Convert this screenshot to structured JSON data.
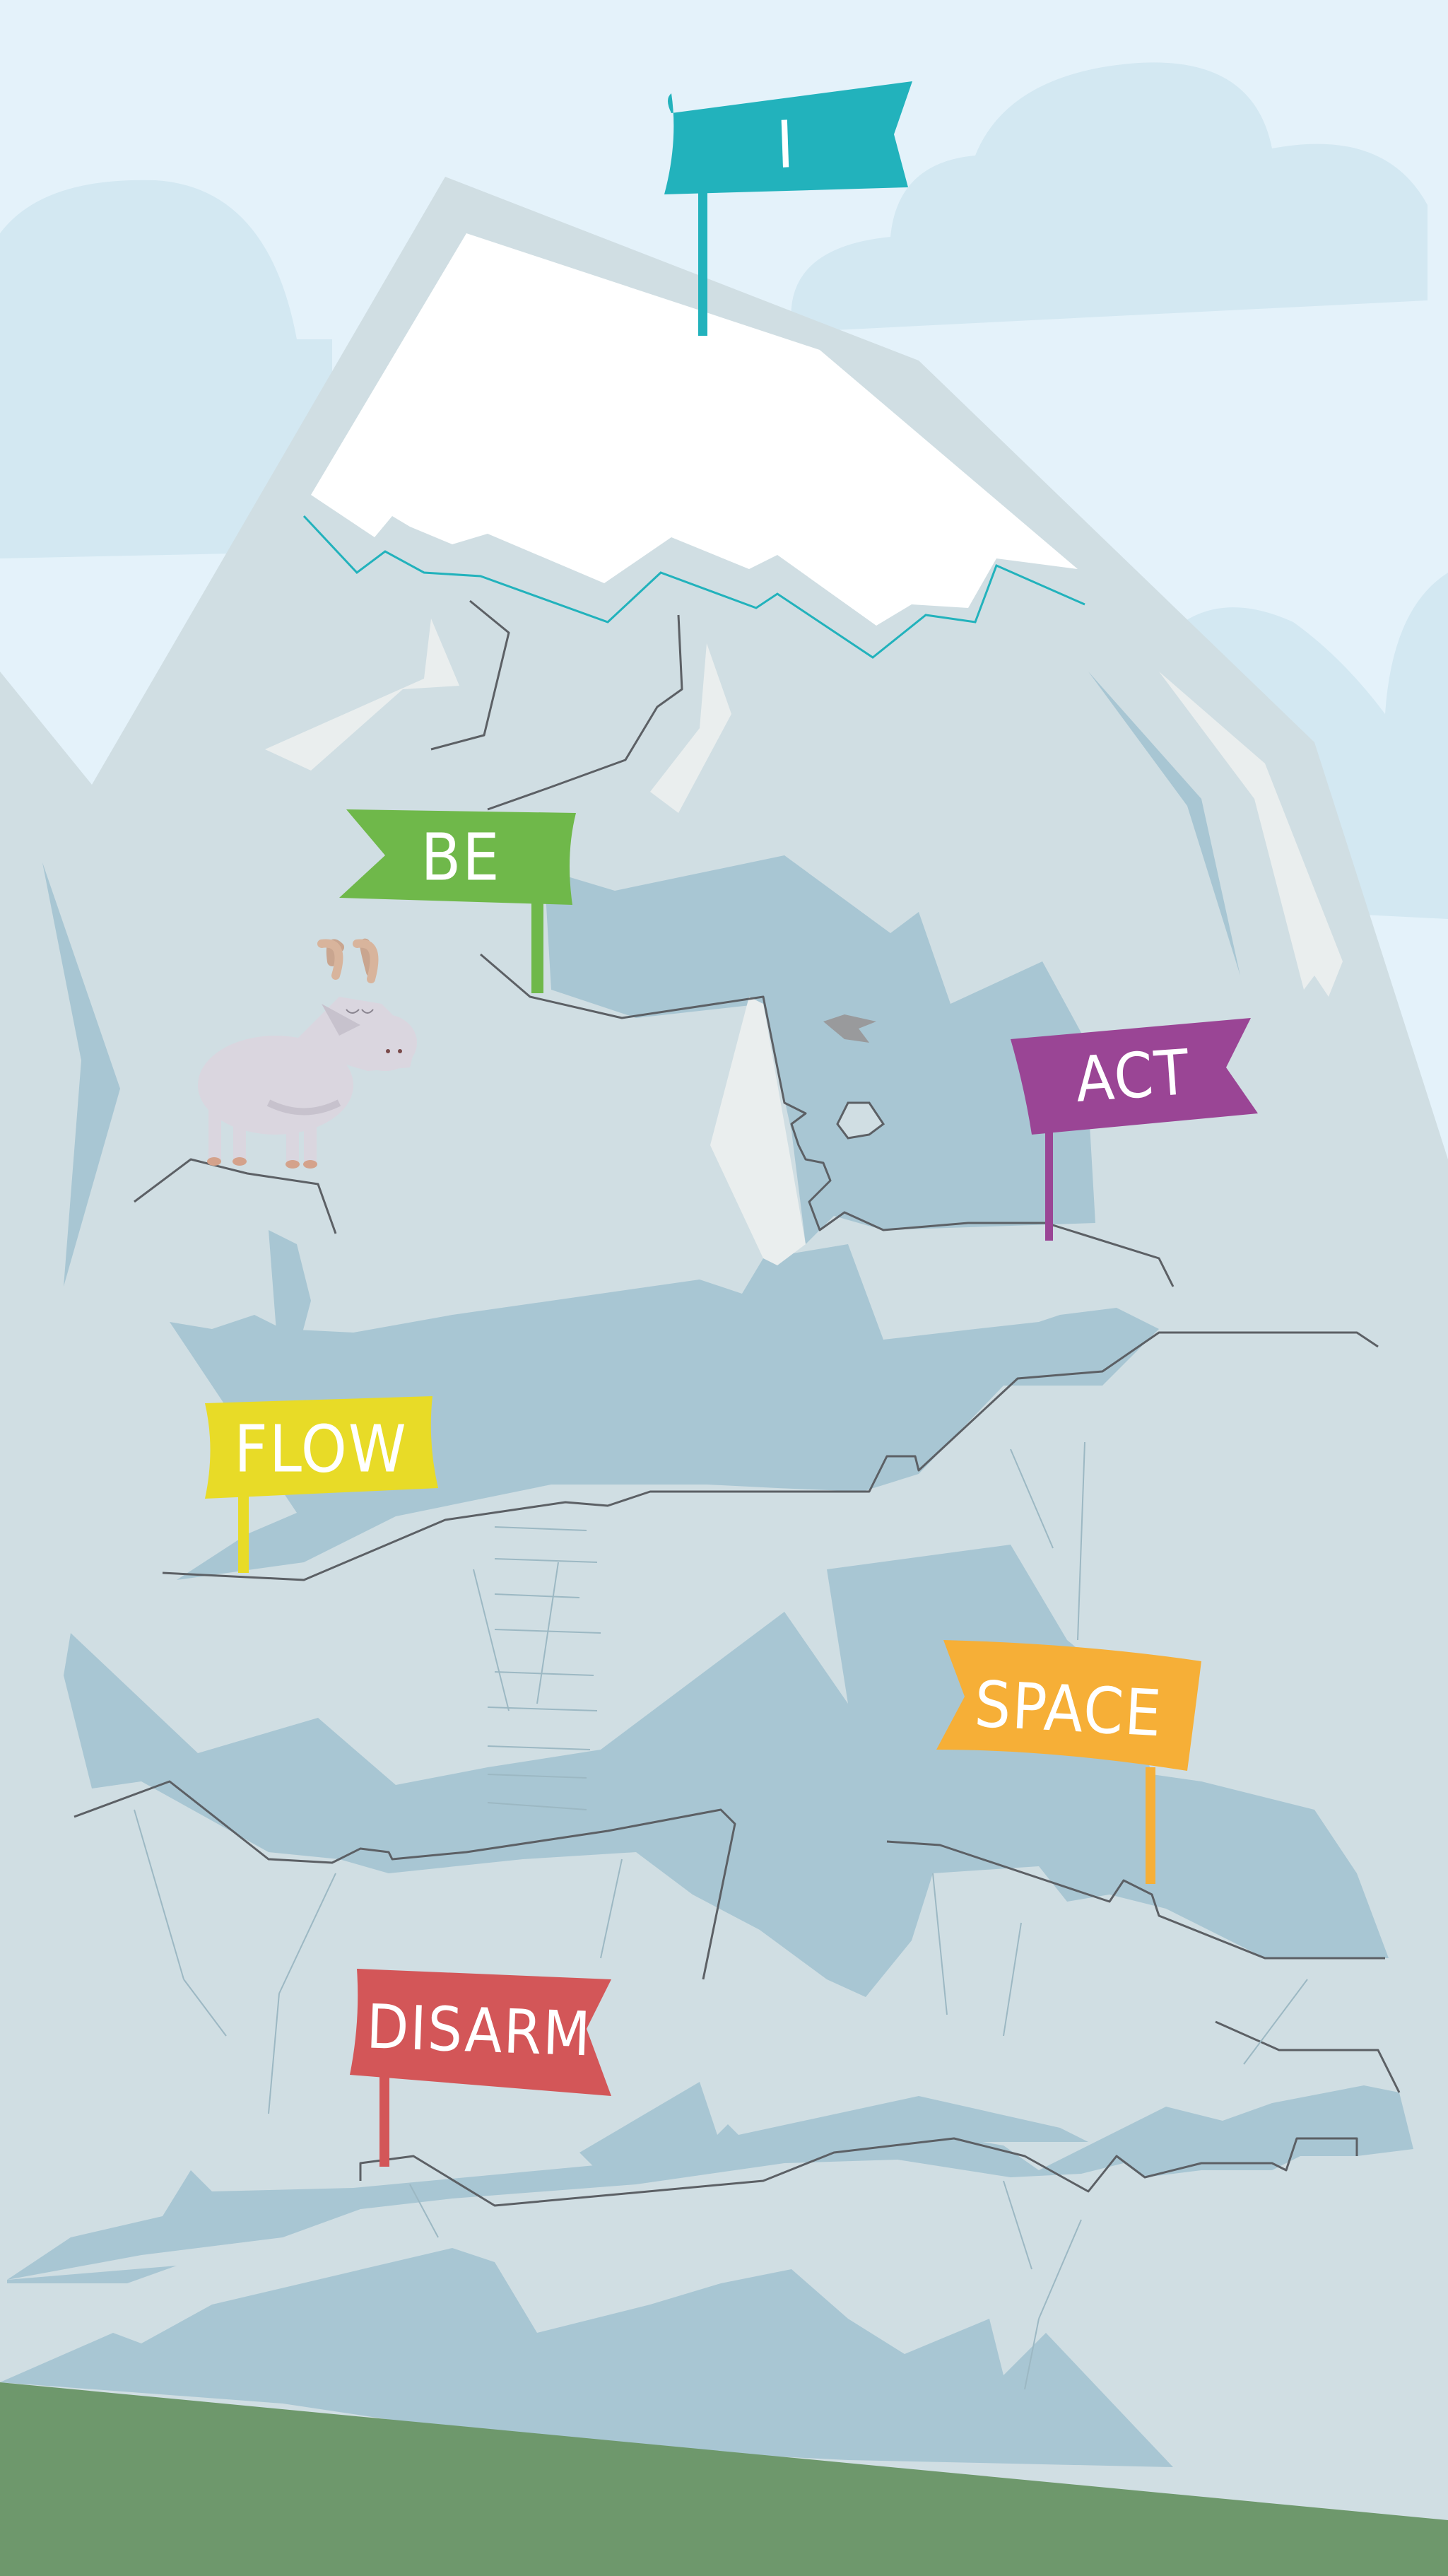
{
  "flags": [
    {
      "id": "i",
      "label": "I",
      "color": "#22b2bc"
    },
    {
      "id": "be",
      "label": "BE",
      "color": "#6fb84a"
    },
    {
      "id": "act",
      "label": "ACT",
      "color": "#9a4595"
    },
    {
      "id": "flow",
      "label": "FLOW",
      "color": "#e8db27"
    },
    {
      "id": "space",
      "label": "SPACE",
      "color": "#f6af37"
    },
    {
      "id": "disarm",
      "label": "DISARM",
      "color": "#d35658"
    }
  ],
  "colors": {
    "sky": "#e4f2fa",
    "cloud": "#d3e8f2",
    "mountain": "#d0dee3",
    "shadow": "#a8c6d3",
    "snow": "#ffffff",
    "grass": "#6e986c"
  }
}
